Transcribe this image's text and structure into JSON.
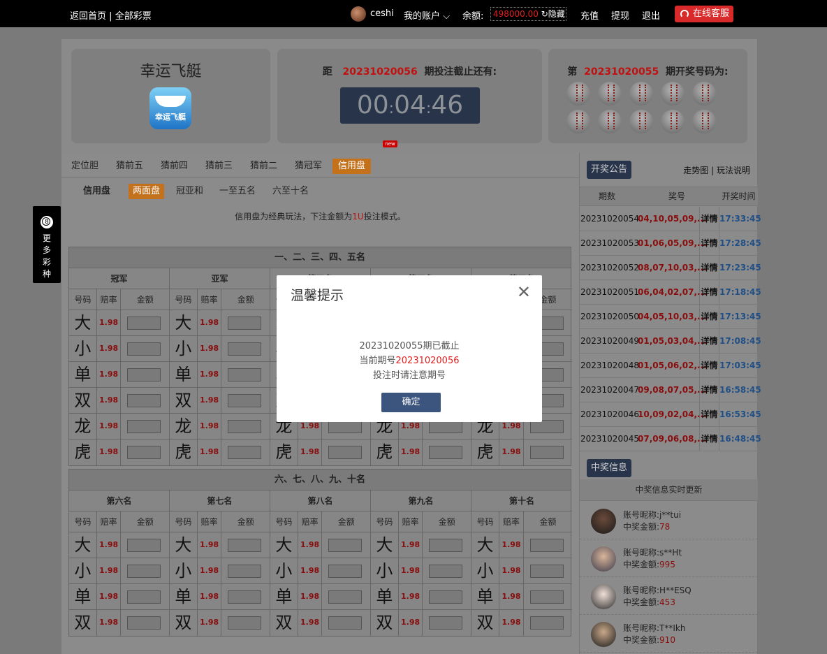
{
  "topbar": {
    "home": "返回首页",
    "sep": "|",
    "all": "全部彩票",
    "username": "ceshi",
    "account": "我的账户",
    "balance_label": "余额:",
    "balance": "498000.00",
    "hide": "隐藏",
    "recharge": "充值",
    "withdraw": "提现",
    "logout": "退出",
    "service": "在线客服"
  },
  "game": {
    "name": "幸运飞艇",
    "logo_text": "幸运飞艇",
    "countdown_prefix": "距",
    "next_issue": "20231020056",
    "countdown_suffix": "期投注截止还有:",
    "timer": {
      "hh": "00",
      "mm": "04",
      "ss": "46"
    },
    "new_tag": "new",
    "result_prefix": "第",
    "current_issue": "20231020055",
    "result_suffix": "期开奖号码为:"
  },
  "tabs": [
    "定位胆",
    "猜前五",
    "猜前四",
    "猜前三",
    "猜前二",
    "猜冠军",
    "信用盘"
  ],
  "active_tab": "信用盘",
  "subtabs": [
    "信用盘",
    "两面盘",
    "冠亚和",
    "一至五名",
    "六至十名"
  ],
  "note": {
    "pre": "信用盘为经典玩法，下注金额为",
    "hl": "1U",
    "post": "投注模式。"
  },
  "group1": {
    "title": "一、二、三、四、五名",
    "cols": [
      "冠军",
      "亚军",
      "第三名",
      "第四名",
      "第五名"
    ],
    "rows": [
      "大",
      "小",
      "单",
      "双",
      "龙",
      "虎"
    ]
  },
  "group2": {
    "title": "六、七、八、九、十名",
    "cols": [
      "第六名",
      "第七名",
      "第八名",
      "第九名",
      "第十名"
    ],
    "rows": [
      "大",
      "小",
      "单",
      "双"
    ]
  },
  "headers": {
    "num": "号码",
    "odds": "赔率",
    "amount": "金额"
  },
  "odds": "1.98",
  "side": {
    "text": "更多彩种",
    "icon": "8"
  },
  "draws": {
    "notice": "开奖公告",
    "trend": "走势图",
    "sep": "|",
    "rules": "玩法说明",
    "head": [
      "期数",
      "奖号",
      "开奖时间"
    ],
    "detail": "详情",
    "rows": [
      {
        "issue": "20231020054",
        "nums": "04,10,05,09,...",
        "time": "17:33:45"
      },
      {
        "issue": "20231020053",
        "nums": "01,06,05,09,...",
        "time": "17:28:45"
      },
      {
        "issue": "20231020052",
        "nums": "08,07,10,03,...",
        "time": "17:23:45"
      },
      {
        "issue": "20231020051",
        "nums": "06,04,02,07,...",
        "time": "17:18:45"
      },
      {
        "issue": "20231020050",
        "nums": "04,05,10,03,...",
        "time": "17:13:45"
      },
      {
        "issue": "20231020049",
        "nums": "01,05,03,04,...",
        "time": "17:08:45"
      },
      {
        "issue": "20231020048",
        "nums": "01,05,06,02,...",
        "time": "17:03:45"
      },
      {
        "issue": "20231020047",
        "nums": "09,08,07,05,...",
        "time": "16:58:45"
      },
      {
        "issue": "20231020046",
        "nums": "10,09,02,04,...",
        "time": "16:53:45"
      },
      {
        "issue": "20231020045",
        "nums": "07,09,06,08,...",
        "time": "16:48:45"
      }
    ]
  },
  "winners": {
    "title": "中奖信息",
    "head": "中奖信息实时更新",
    "name_label": "账号昵称:",
    "amount_label": "中奖金额:",
    "list": [
      {
        "name": "j**tui",
        "amount": "78"
      },
      {
        "name": "s**Ht",
        "amount": "995"
      },
      {
        "name": "H**ESQ",
        "amount": "453"
      },
      {
        "name": "T**Ikh",
        "amount": "910"
      }
    ]
  },
  "dialog": {
    "title": "温馨提示",
    "close": "✕",
    "line1": "20231020055期已截止",
    "line2_pre": "当前期号",
    "line2_issue": "20231020056",
    "line3": "投注时请注意期号",
    "ok": "确定"
  }
}
